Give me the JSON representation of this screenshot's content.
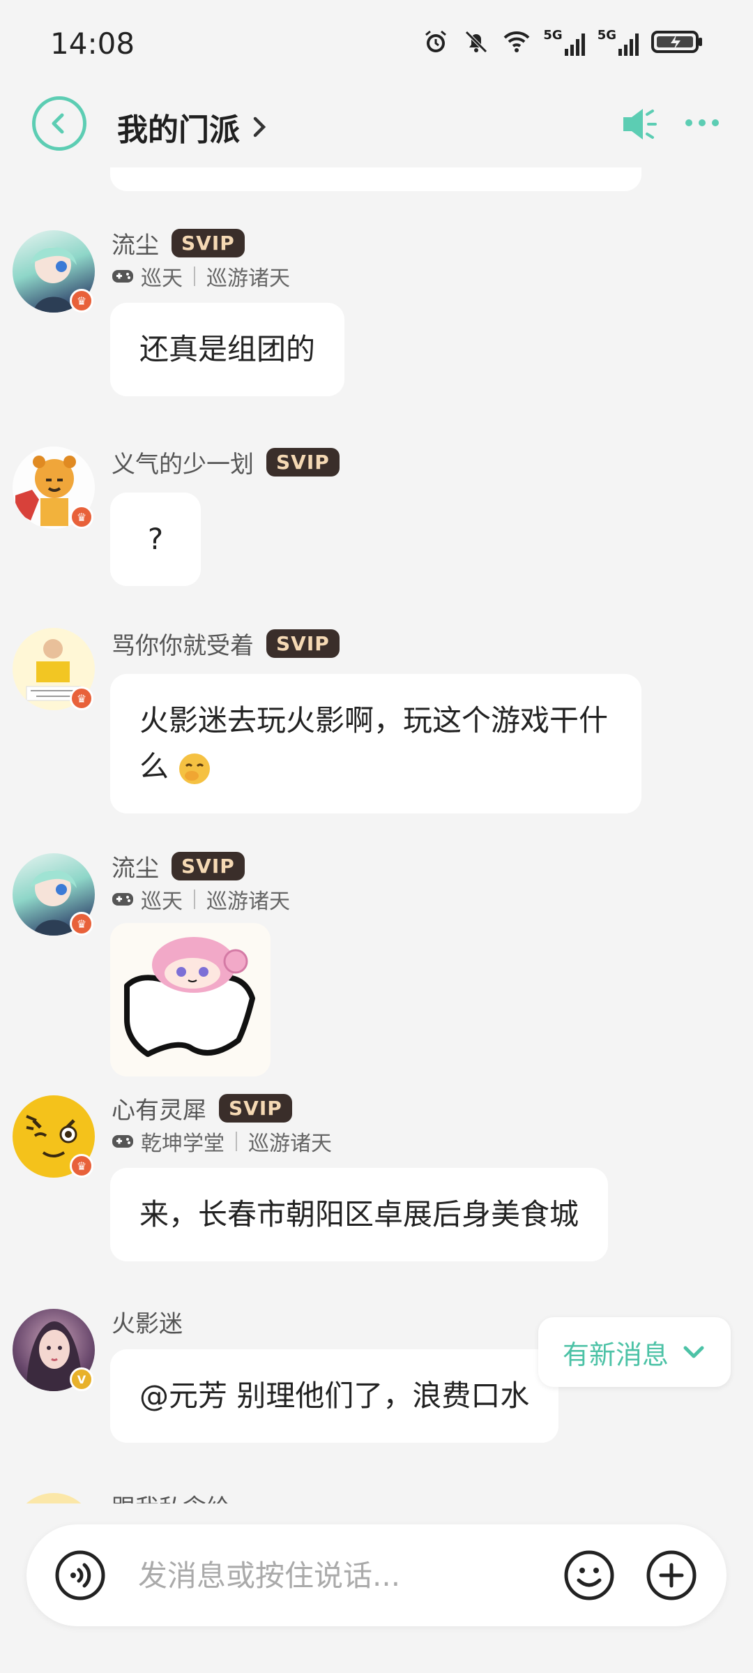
{
  "status_bar": {
    "time": "14:08",
    "icons": [
      "alarm-icon",
      "bell-muted-icon",
      "wifi-icon",
      "signal-5g-icon",
      "signal-5g-icon",
      "battery-charging-icon"
    ],
    "network_label_1": "5G",
    "network_label_2": "5G"
  },
  "header": {
    "title": "我的门派",
    "back_icon": "back-arrow-icon",
    "chevron_icon": "chevron-right-icon",
    "speaker_icon": "speaker-icon",
    "more_icon": "more-dots-icon",
    "accent_color": "#5ccdb3"
  },
  "messages": [
    {
      "name": "流尘",
      "badge": "SVIP",
      "game_tag": "巡天",
      "server_tag": "巡游诸天",
      "text": "还真是组团的"
    },
    {
      "name": "义气的少一划",
      "badge": "SVIP",
      "text": "?"
    },
    {
      "name": "骂你你就受着",
      "badge": "SVIP",
      "text": "火影迷去玩火影啊，玩这个游戏干什么"
    },
    {
      "name": "流尘",
      "badge": "SVIP",
      "game_tag": "巡天",
      "server_tag": "巡游诸天",
      "sticker": "anime-girl-sticker"
    },
    {
      "name": "心有灵犀",
      "badge": "SVIP",
      "game_tag": "乾坤学堂",
      "server_tag": "巡游诸天",
      "text": "来，长春市朝阳区卓展后身美食城"
    },
    {
      "name": "火影迷",
      "text": "@元芳 别理他们了，浪费口水"
    },
    {
      "name": "跟我私念给"
    }
  ],
  "new_message_pill": {
    "label": "有新消息"
  },
  "input_bar": {
    "placeholder": "发消息或按住说话...",
    "value": ""
  }
}
